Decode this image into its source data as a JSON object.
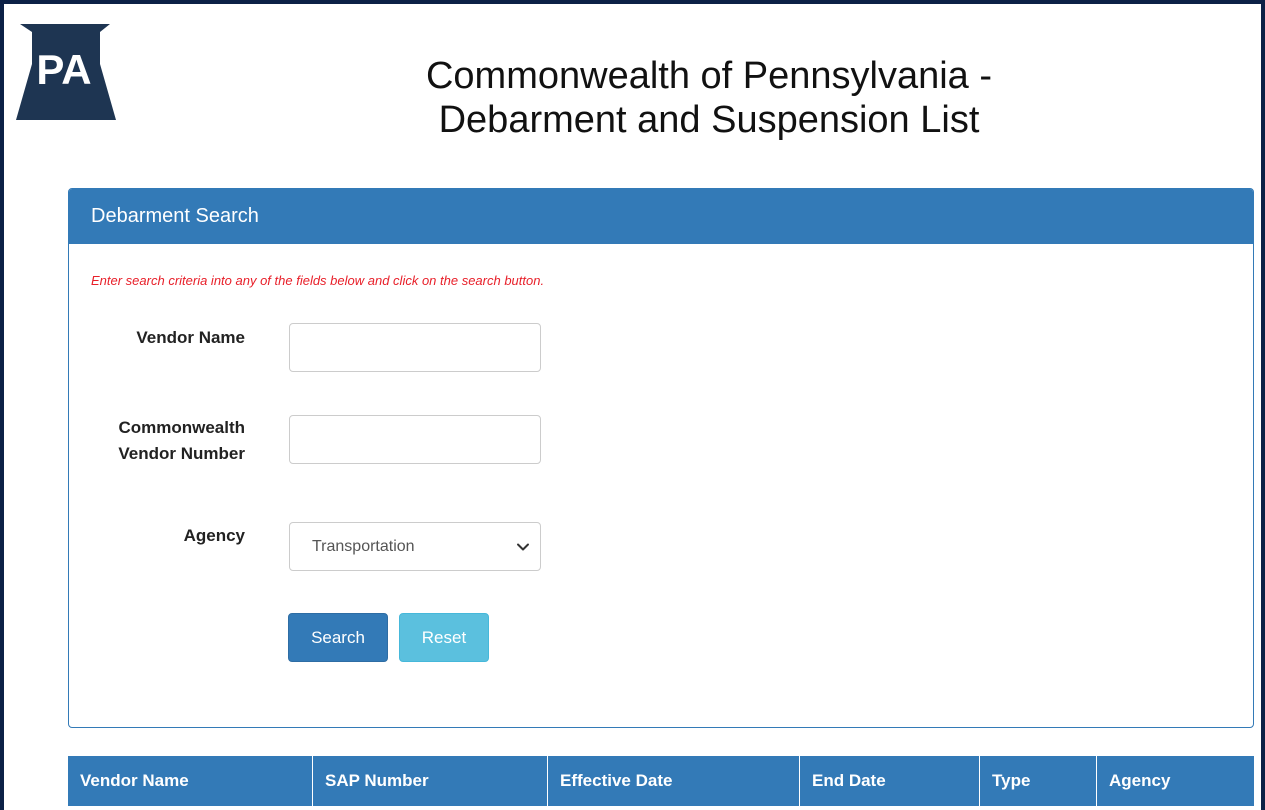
{
  "header": {
    "logo_text": "PA",
    "title_line1": "Commonwealth of Pennsylvania -",
    "title_line2": "Debarment and Suspension List"
  },
  "search_panel": {
    "heading": "Debarment Search",
    "instructions": "Enter search criteria into any of the fields below and click on the search button.",
    "fields": {
      "vendor_name_label": "Vendor Name",
      "vendor_name_value": "",
      "vendor_number_label_line1": "Commonwealth",
      "vendor_number_label_line2": "Vendor Number",
      "vendor_number_value": "",
      "agency_label": "Agency",
      "agency_selected": "Transportation"
    },
    "buttons": {
      "search": "Search",
      "reset": "Reset"
    }
  },
  "results_table": {
    "columns": [
      "Vendor Name",
      "SAP Number",
      "Effective Date",
      "End Date",
      "Type",
      "Agency"
    ]
  },
  "colors": {
    "primary": "#337ab7",
    "info": "#5bc0de",
    "frame": "#0c2146",
    "logo": "#1e3552",
    "instruction_text": "#e8202a"
  },
  "icons": {
    "logo": "keystone-logo",
    "select_arrow": "chevron-down-icon"
  }
}
